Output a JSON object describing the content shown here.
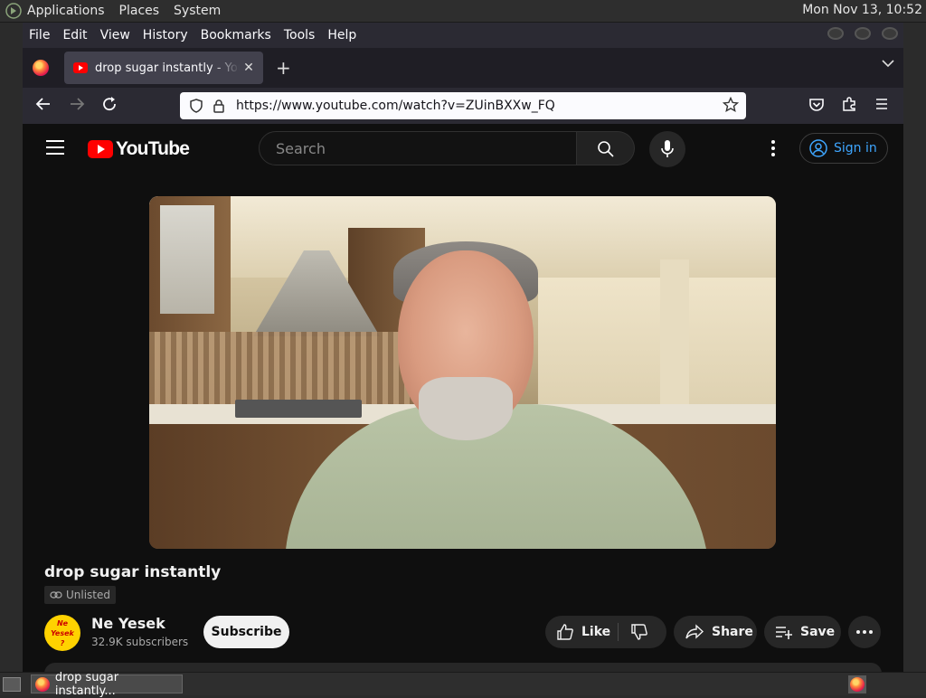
{
  "top_panel": {
    "menus": [
      "Applications",
      "Places",
      "System"
    ],
    "clock": "Mon Nov 13, 10:52"
  },
  "menubar": {
    "items": [
      {
        "label": "File",
        "key": "F"
      },
      {
        "label": "Edit",
        "key": "E"
      },
      {
        "label": "View",
        "key": "V"
      },
      {
        "label": "History",
        "key": "s"
      },
      {
        "label": "Bookmarks",
        "key": "B"
      },
      {
        "label": "Tools",
        "key": "T"
      },
      {
        "label": "Help",
        "key": "H"
      }
    ]
  },
  "tab": {
    "title": "drop sugar instantly - YouTube",
    "close": "✕",
    "new_tab": "+"
  },
  "navbar": {
    "url": "https://www.youtube.com/watch?v=ZUinBXXw_FQ"
  },
  "youtube": {
    "logo_text": "YouTube",
    "search_placeholder": "Search",
    "sign_in": "Sign in",
    "video_title": "drop sugar instantly",
    "visibility": "Unlisted",
    "channel": {
      "name": "Ne Yesek",
      "subscribers": "32.9K subscribers",
      "avatar_text": "Ne Yesek ?"
    },
    "subscribe": "Subscribe",
    "like": "Like",
    "share": "Share",
    "save": "Save"
  },
  "taskbar": {
    "window_title": "drop sugar instantly..."
  },
  "colors": {
    "youtube_red": "#ff0000",
    "sign_in_blue": "#3ea6ff",
    "page_bg": "#0f0f0f"
  }
}
